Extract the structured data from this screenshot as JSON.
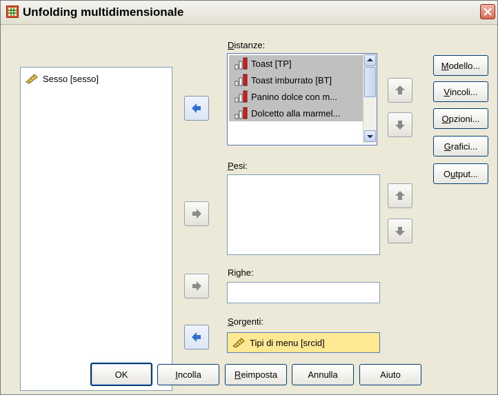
{
  "window": {
    "title": "Unfolding multidimensionale"
  },
  "source_list": {
    "items": [
      {
        "label": "Sesso [sesso]",
        "icon": "ruler-icon"
      }
    ]
  },
  "distances": {
    "label_prefix": "D",
    "label_rest": "istanze:",
    "items": [
      {
        "label": "Toast [TP]",
        "icon": "scale-bar-icon"
      },
      {
        "label": "Toast imburrato [BT]",
        "icon": "scale-bar-icon"
      },
      {
        "label": "Panino dolce con m...",
        "icon": "scale-bar-icon"
      },
      {
        "label": "Dolcetto alla marmel...",
        "icon": "scale-bar-icon"
      }
    ]
  },
  "weights": {
    "label_prefix": "P",
    "label_rest": "esi:"
  },
  "rows": {
    "label": "Righe:"
  },
  "sources": {
    "label_prefix": "S",
    "label_rest": "orgenti:",
    "value": "Tipi di menu [srcid]"
  },
  "side_buttons": {
    "model": {
      "u": "M",
      "rest": "odello..."
    },
    "constraints": {
      "u": "V",
      "rest": "incoli..."
    },
    "options": {
      "u": "O",
      "rest": "pzioni..."
    },
    "plots": {
      "u": "G",
      "rest": "rafici..."
    },
    "output": {
      "pre": "O",
      "u": "u",
      "rest": "tput..."
    }
  },
  "bottom_buttons": {
    "ok": "OK",
    "paste": {
      "u": "I",
      "rest": "ncolla"
    },
    "reset": {
      "u": "R",
      "rest": "eimposta"
    },
    "cancel": "Annulla",
    "help": "Aiuto"
  },
  "colors": {
    "accent": "#2f6fd3",
    "sources_bg": "#fde893",
    "selection": "#c0c0c0"
  }
}
